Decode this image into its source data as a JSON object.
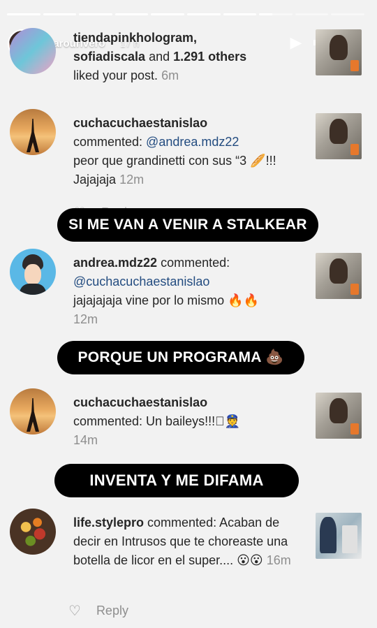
{
  "story": {
    "username": "marourivero",
    "time": "17 h",
    "progress": [
      1,
      1,
      1,
      1,
      1,
      1,
      1,
      0.4,
      0,
      0
    ],
    "controls": {
      "play_icon": "play-icon",
      "mute_icon": "mute-icon",
      "more_icon": "more-icon"
    }
  },
  "notifications": [
    {
      "user_a": "tiendapinkhologram,",
      "user_b": "sofiadiscala",
      "middle": " and ",
      "others": "1.291 others",
      "text": "liked your post.",
      "time": "6m"
    },
    {
      "username": "cuchacuchaestanislao",
      "verb": "commented: ",
      "mention": "@andrea.mdz22",
      "text": "peor que grandinetti con sus “3 🥖!!! Jajajaja",
      "time": "12m"
    },
    {
      "username": "andrea.mdz22",
      "verb": " commented:",
      "mention": "@cuchacuchaestanislao",
      "text": "jajajajaja vine por lo mismo 🔥🔥",
      "time": "12m"
    },
    {
      "username": "cuchacuchaestanislao",
      "verb": "commented: Un baileys!!!🏽👮",
      "time": "14m"
    },
    {
      "username": "life.stylepro",
      "verb": " commented: Acaban de decir en Intrusos que te choreaste una botella de licor en el super.... 😮😮",
      "time": "16m"
    }
  ],
  "reply_label": "Reply",
  "banners": [
    "SI ME VAN A VENIR A STALKEAR",
    "PORQUE UN PROGRAMA 💩",
    "INVENTA Y ME DIFAMA"
  ]
}
